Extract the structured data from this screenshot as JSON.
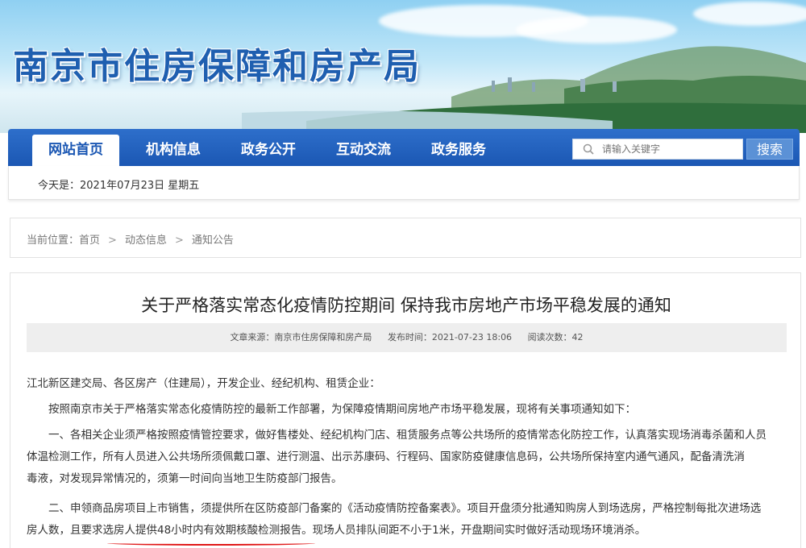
{
  "banner": {
    "title": "南京市住房保障和房产局"
  },
  "nav": {
    "items": [
      {
        "label": "网站首页",
        "active": true
      },
      {
        "label": "机构信息",
        "active": false
      },
      {
        "label": "政务公开",
        "active": false
      },
      {
        "label": "互动交流",
        "active": false
      },
      {
        "label": "政务服务",
        "active": false
      }
    ],
    "search_placeholder": "请输入关键字",
    "search_button": "搜索"
  },
  "date": {
    "text": "今天是：2021年07月23日  星期五"
  },
  "breadcrumb": {
    "prefix": "当前位置：",
    "items": [
      "首页",
      "动态信息",
      "通知公告"
    ]
  },
  "article": {
    "title": "关于严格落实常态化疫情防控期间 保持我市房地产市场平稳发展的通知",
    "source": "文章来源：南京市住房保障和房产局",
    "published": "发布时间：2021-07-23 18:06",
    "views": "阅读次数：42",
    "paragraphs": [
      "江北新区建交局、各区房产（住建局），开发企业、经纪机构、租赁企业：",
      "　　按照南京市关于严格落实常态化疫情防控的最新工作部署，为保障疫情期间房地产市场平稳发展，现将有关事项通知如下：",
      "　　一、各相关企业须严格按照疫情管控要求，做好售楼处、经纪机构门店、租赁服务点等公共场所的疫情常态化防控工作，认真落实现场消毒杀菌和人员",
      "体温检测工作，所有人员进入公共场所须佩戴口罩、进行测温、出示苏康码、行程码、国家防疫健康信息码，公共场所保持室内通气通风，配备清洗消",
      "毒液，对发现异常情况的，须第一时间向当地卫生防疫部门报告。",
      "　　二、申领商品房项目上市销售，须提供所在区防疫部门备案的《活动疫情防控备案表》。项目开盘须分批通知购房人到场选房，严格控制每批次进场选",
      "房人数，且要求选房人提供48小时内有效期核酸检测报告。现场人员排队间距不小于1米，开盘期间实时做好活动现场环境消杀。"
    ]
  },
  "colors": {
    "nav_blue": "#1b57b3",
    "title_blue": "#1f5fb0",
    "highlight_red": "#e01818"
  }
}
